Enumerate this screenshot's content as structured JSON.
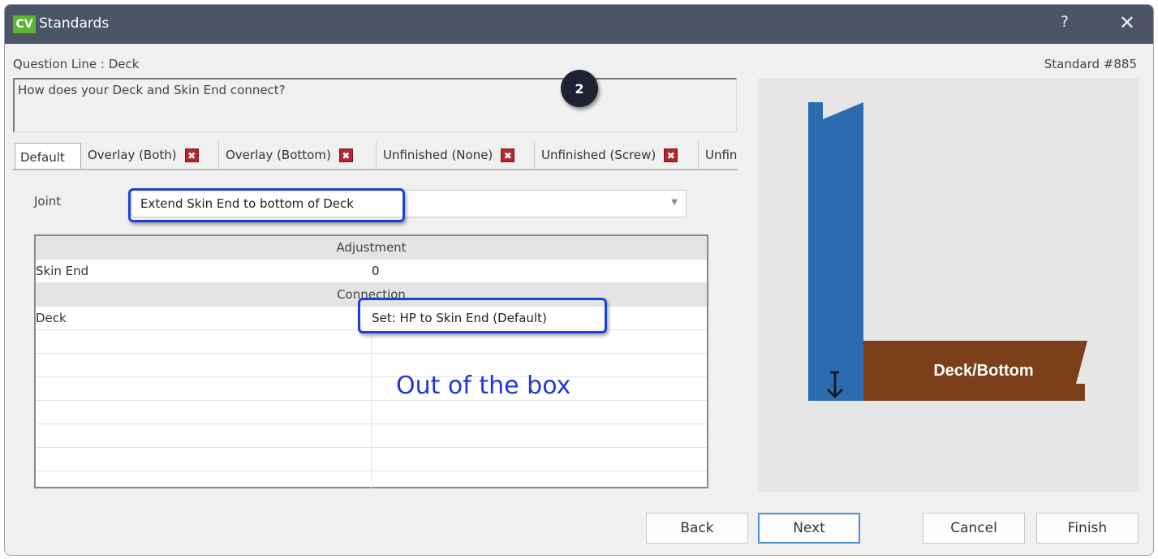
{
  "window": {
    "app_logo": "CV",
    "title": "Standards",
    "help_label": "?",
    "close_label": "✕"
  },
  "header": {
    "question_line": "Question Line : Deck",
    "standard_number": "Standard #885"
  },
  "question": {
    "text": "How does your Deck and Skin End connect?"
  },
  "step_badge": "2",
  "tabs": [
    {
      "label": "Default",
      "active": true,
      "removable": false
    },
    {
      "label": "Overlay (Both)",
      "removable": true
    },
    {
      "label": "Overlay (Bottom)",
      "removable": true
    },
    {
      "label": "Unfinished (None)",
      "removable": true
    },
    {
      "label": "Unfinished (Screw)",
      "removable": true
    },
    {
      "label": "Unfin",
      "removable": false
    }
  ],
  "tab_remove_icon": "✖",
  "joint": {
    "label": "Joint",
    "value": "Extend Skin End to bottom of Deck",
    "arrow": "▼"
  },
  "grid": {
    "sections": [
      {
        "title": "Adjustment",
        "rows": [
          {
            "name": "Skin End",
            "value": "0"
          }
        ]
      },
      {
        "title": "Connection",
        "rows": [
          {
            "name": "Deck",
            "value": "Set: HP to Skin End (Default)"
          }
        ]
      }
    ]
  },
  "annotation": {
    "text": "Out of the box",
    "color": "#2136d9"
  },
  "preview": {
    "label": "Deck/Bottom",
    "skin_color": "#2b6cb0",
    "deck_color": "#7b4019",
    "icon": "arrow-to-bottom-icon"
  },
  "buttons": {
    "back": "Back",
    "next": "Next",
    "cancel": "Cancel",
    "finish": "Finish"
  }
}
